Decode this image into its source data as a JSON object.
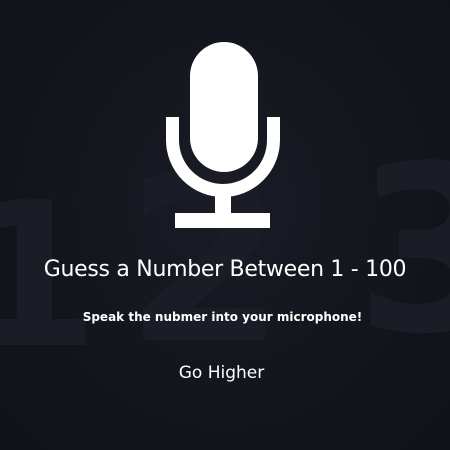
{
  "app": {
    "title": "Guess a Number Between 1 - 100",
    "instruction": "Speak the nubmer into your microphone!",
    "feedback": "Go Higher"
  },
  "icons": {
    "microphone": "microphone-icon"
  },
  "colors": {
    "background": "#12141b",
    "text": "#ffffff",
    "decorative_digits": "#1e2029"
  }
}
